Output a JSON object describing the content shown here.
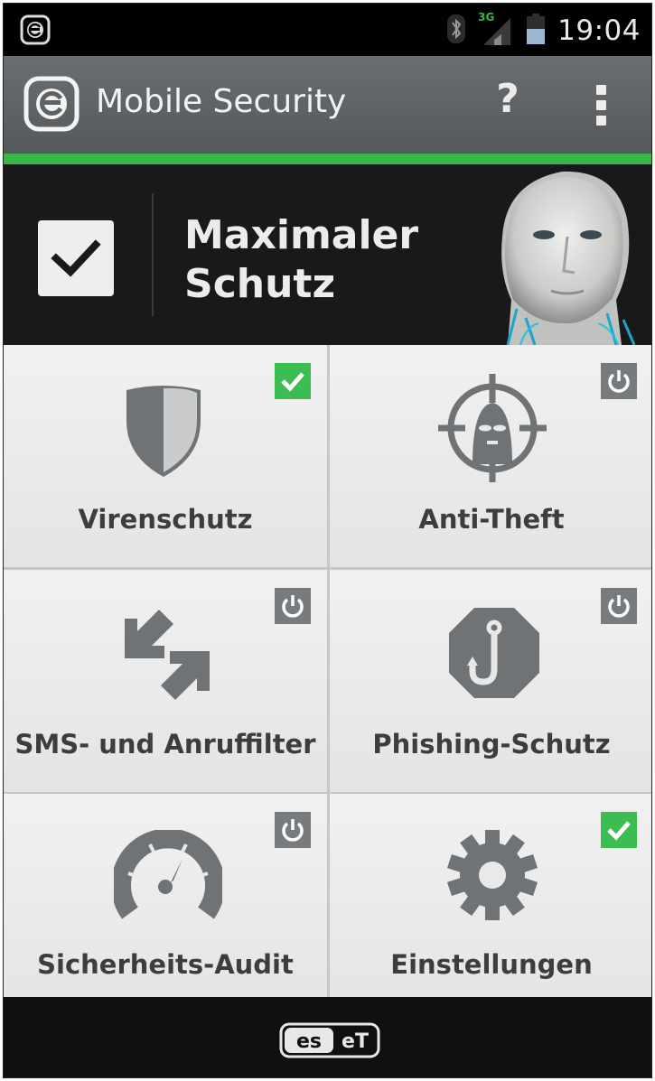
{
  "status_bar": {
    "network": "3G",
    "time": "19:04"
  },
  "action_bar": {
    "title": "Mobile Security",
    "help_label": "?"
  },
  "hero": {
    "status_line1": "Maximaler",
    "status_line2": "Schutz"
  },
  "modules": [
    {
      "label": "Virenschutz",
      "icon": "shield-icon",
      "state": "enabled"
    },
    {
      "label": "Anti-Theft",
      "icon": "target-thief-icon",
      "state": "disabled"
    },
    {
      "label": "SMS- und Anruffilter",
      "icon": "arrows-icon",
      "state": "disabled"
    },
    {
      "label": "Phishing-Schutz",
      "icon": "hook-icon",
      "state": "disabled"
    },
    {
      "label": "Sicherheits-Audit",
      "icon": "gauge-icon",
      "state": "disabled"
    },
    {
      "label": "Einstellungen",
      "icon": "gear-icon",
      "state": "enabled"
    }
  ],
  "footer": {
    "brand": "ESET"
  },
  "colors": {
    "accent_green": "#39b54a",
    "action_bar": "#5f6365",
    "icon_gray": "#6f7375"
  }
}
